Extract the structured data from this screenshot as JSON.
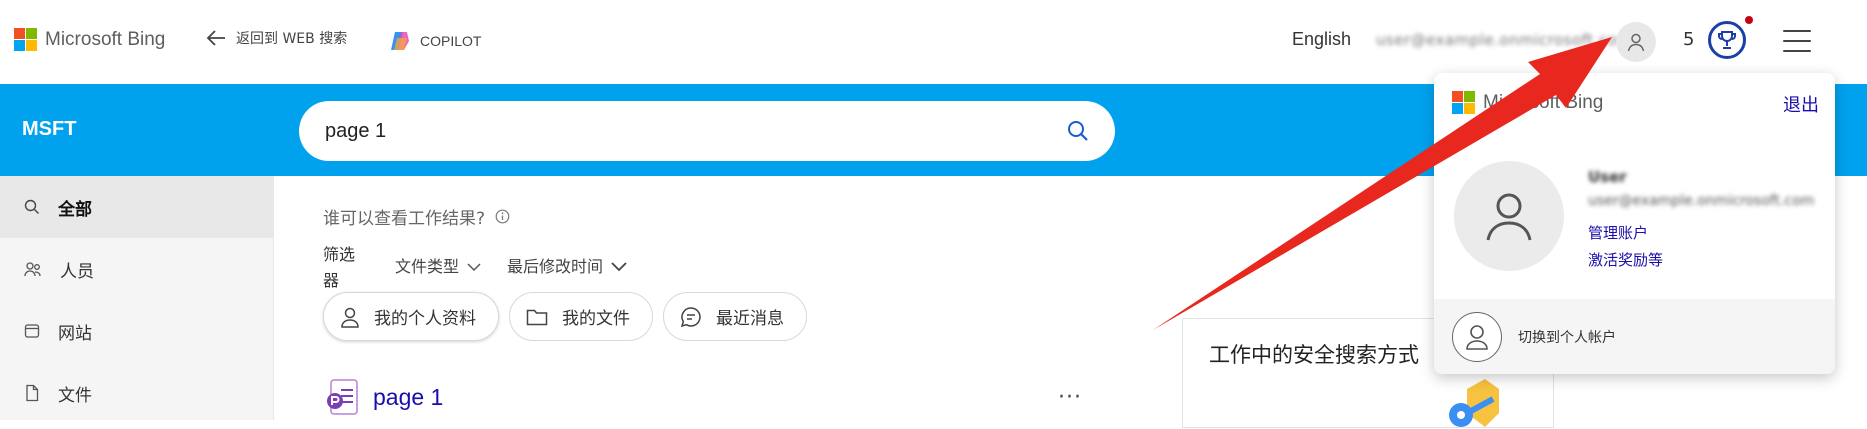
{
  "header": {
    "brand": "Microsoft Bing",
    "back_label": "返回到 WEB 搜索",
    "copilot_label": "COPILOT",
    "language": "English",
    "email": "user@example.onmicrosoft.com",
    "points": "5"
  },
  "colors": {
    "ms_red": "#f25022",
    "ms_green": "#7fba00",
    "ms_blue": "#00a4ef",
    "ms_yellow": "#ffb900",
    "banner_blue": "#00a2ed",
    "link": "#1a0dab",
    "arrow": "#e8271f"
  },
  "banner": {
    "org": "MSFT",
    "search_value": "page 1"
  },
  "sidebar": {
    "items": [
      {
        "label": "全部",
        "icon": "search-icon"
      },
      {
        "label": "人员",
        "icon": "people-icon"
      },
      {
        "label": "网站",
        "icon": "site-icon"
      },
      {
        "label": "文件",
        "icon": "file-icon"
      }
    ]
  },
  "main": {
    "who_can_see": "谁可以查看工作结果?",
    "filter_label": "筛选器",
    "filter_type": "文件类型",
    "filter_modified": "最后修改时间",
    "chips": [
      "我的个人资料",
      "我的文件",
      "最近消息"
    ],
    "result_title": "page 1",
    "more": "···"
  },
  "side_card": {
    "title": "工作中的安全搜索方式"
  },
  "popup": {
    "brand": "Microsoft Bing",
    "signout": "退出",
    "name": "User",
    "email": "user@example.onmicrosoft.com",
    "manage_account": "管理账户",
    "activate_rewards": "激活奖励等",
    "switch_personal": "切换到个人帐户"
  }
}
